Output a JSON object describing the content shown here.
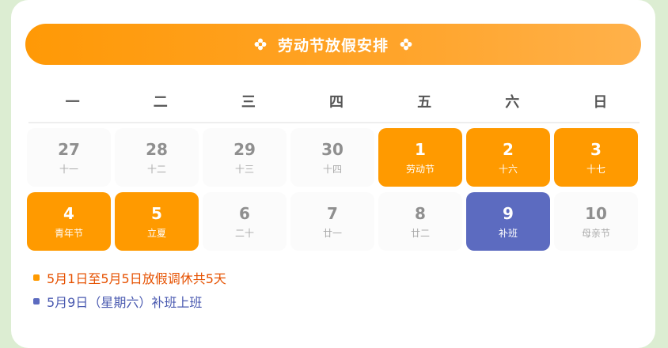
{
  "banner": {
    "title": "劳动节放假安排",
    "left_icon": "flower-icon",
    "right_icon": "flower-icon"
  },
  "weekdays": [
    "一",
    "二",
    "三",
    "四",
    "五",
    "六",
    "日"
  ],
  "days": [
    {
      "num": "27",
      "sub": "十一",
      "type": "normal"
    },
    {
      "num": "28",
      "sub": "十二",
      "type": "normal"
    },
    {
      "num": "29",
      "sub": "十三",
      "type": "normal"
    },
    {
      "num": "30",
      "sub": "十四",
      "type": "normal"
    },
    {
      "num": "1",
      "sub": "劳动节",
      "type": "holiday"
    },
    {
      "num": "2",
      "sub": "十六",
      "type": "holiday"
    },
    {
      "num": "3",
      "sub": "十七",
      "type": "holiday"
    },
    {
      "num": "4",
      "sub": "青年节",
      "type": "holiday"
    },
    {
      "num": "5",
      "sub": "立夏",
      "type": "holiday"
    },
    {
      "num": "6",
      "sub": "二十",
      "type": "normal"
    },
    {
      "num": "7",
      "sub": "廿一",
      "type": "normal"
    },
    {
      "num": "8",
      "sub": "廿二",
      "type": "normal"
    },
    {
      "num": "9",
      "sub": "补班",
      "type": "work"
    },
    {
      "num": "10",
      "sub": "母亲节",
      "type": "normal"
    }
  ],
  "notes": [
    "5月1日至5月5日放假调休共5天",
    "5月9日（星期六）补班上班"
  ],
  "colors": {
    "holiday": "#ff9a00",
    "work": "#5c6bc0",
    "background": "#dcedd2"
  }
}
